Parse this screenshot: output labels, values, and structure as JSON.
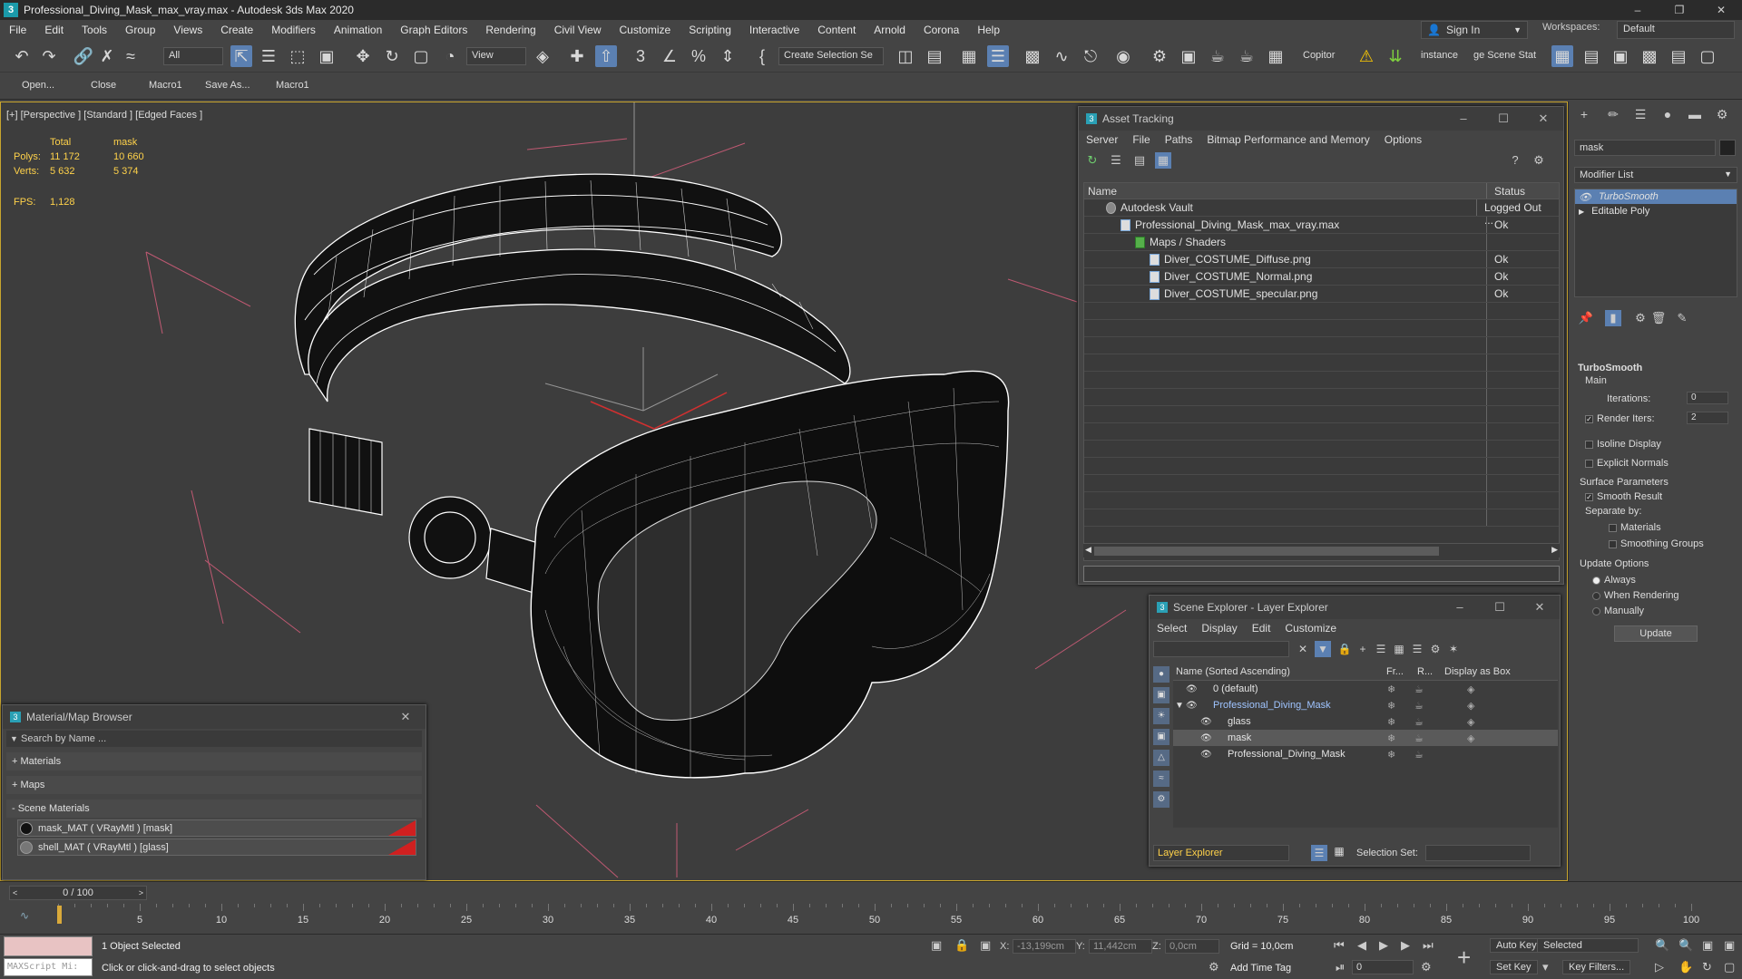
{
  "window": {
    "title": "Professional_Diving_Mask_max_vray.max - Autodesk 3ds Max 2020"
  },
  "menu": [
    "File",
    "Edit",
    "Tools",
    "Group",
    "Views",
    "Create",
    "Modifiers",
    "Animation",
    "Graph Editors",
    "Rendering",
    "Civil View",
    "Customize",
    "Scripting",
    "Interactive",
    "Content",
    "Arnold",
    "Corona",
    "Help"
  ],
  "signin": {
    "label": "Sign In"
  },
  "workspaces": {
    "label": "Workspaces:",
    "value": "Default"
  },
  "toolbar": {
    "filter_value": "All",
    "view_value": "View",
    "selection_set_placeholder": "Create Selection Se",
    "copitor": "Copitor",
    "instance": "instance",
    "scene_state": "ge Scene Stat"
  },
  "quickbar": [
    "Open...",
    "Close",
    "Macro1",
    "Save As...",
    "Macro1"
  ],
  "viewport": {
    "label": "[+] [Perspective ] [Standard ] [Edged Faces ]",
    "stats_headers": [
      "",
      "Total",
      "mask"
    ],
    "stats": [
      {
        "label": "Polys:",
        "total": "11 172",
        "sel": "10 660"
      },
      {
        "label": "Verts:",
        "total": "5 632",
        "sel": "5 374"
      }
    ],
    "fps_label": "FPS:",
    "fps_value": "1,128"
  },
  "asset_tracking": {
    "title": "Asset Tracking",
    "menu": [
      "Server",
      "File",
      "Paths",
      "Bitmap Performance and Memory",
      "Options"
    ],
    "col_name": "Name",
    "col_status": "Status",
    "rows": [
      {
        "name": "Autodesk Vault",
        "status": "Logged Out ..."
      },
      {
        "name": "Professional_Diving_Mask_max_vray.max",
        "status": "Ok"
      },
      {
        "name": "Maps / Shaders",
        "status": ""
      },
      {
        "name": "Diver_COSTUME_Diffuse.png",
        "status": "Ok"
      },
      {
        "name": "Diver_COSTUME_Normal.png",
        "status": "Ok"
      },
      {
        "name": "Diver_COSTUME_specular.png",
        "status": "Ok"
      }
    ]
  },
  "scene_explorer": {
    "title": "Scene Explorer - Layer Explorer",
    "menu": [
      "Select",
      "Display",
      "Edit",
      "Customize"
    ],
    "col_name": "Name (Sorted Ascending)",
    "col_fr": "Fr...",
    "col_r": "R...",
    "col_box": "Display as Box",
    "rows": [
      {
        "name": "0 (default)"
      },
      {
        "name": "Professional_Diving_Mask"
      },
      {
        "name": "glass"
      },
      {
        "name": "mask"
      },
      {
        "name": "Professional_Diving_Mask"
      }
    ],
    "footer_explorer": "Layer Explorer",
    "footer_selset": "Selection Set:"
  },
  "material_browser": {
    "title": "Material/Map Browser",
    "search_placeholder": "Search by Name ...",
    "sections": [
      "+ Materials",
      "+ Maps",
      "- Scene Materials"
    ],
    "materials": [
      "mask_MAT ( VRayMtl ) [mask]",
      "shell_MAT ( VRayMtl ) [glass]"
    ]
  },
  "command_panel": {
    "name_field": "mask",
    "modifier_list": "Modifier List",
    "stack": [
      "TurboSmooth",
      "Editable Poly"
    ],
    "turbosmooth": {
      "title": "TurboSmooth",
      "main": "Main",
      "iterations_label": "Iterations:",
      "iterations": "0",
      "render_iters_label": "Render Iters:",
      "render_iters": "2",
      "isoline": "Isoline Display",
      "explicit": "Explicit Normals",
      "surface": "Surface Parameters",
      "smooth": "Smooth Result",
      "separate": "Separate by:",
      "materials": "Materials",
      "smoothing_groups": "Smoothing Groups",
      "update_options": "Update Options",
      "always": "Always",
      "when_rendering": "When Rendering",
      "manually": "Manually",
      "update_btn": "Update"
    }
  },
  "timeline": {
    "frame": "0 / 100",
    "ticks": [
      "5",
      "10",
      "15",
      "20",
      "25",
      "30",
      "35",
      "40",
      "45",
      "50",
      "55",
      "60",
      "65",
      "70",
      "75",
      "80",
      "85",
      "90",
      "95",
      "100"
    ]
  },
  "status": {
    "maxscript": "MAXScript Mi:",
    "selected": "1 Object Selected",
    "prompt": "Click or click-and-drag to select objects",
    "x_label": "X:",
    "x": "-13,199cm",
    "y_label": "Y:",
    "y": "11,442cm",
    "z_label": "Z:",
    "z": "0,0cm",
    "grid": "Grid = 10,0cm",
    "add_time_tag": "Add Time Tag",
    "auto_key": "Auto Key",
    "set_key": "Set Key",
    "key_mode": "Selected",
    "key_filters": "Key Filters...",
    "frame_field": "0"
  }
}
